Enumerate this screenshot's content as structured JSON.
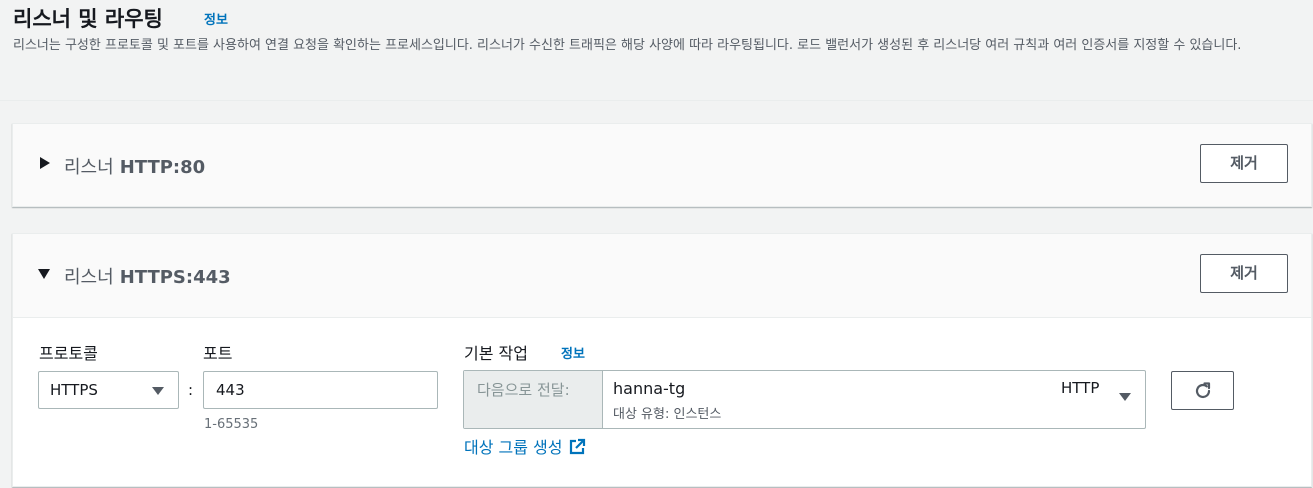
{
  "header": {
    "title": "리스너 및 라우팅",
    "info_link": "정보",
    "description": "리스너는 구성한 프로토콜 및 포트를 사용하여 연결 요청을 확인하는 프로세스입니다. 리스너가 수신한 트래픽은 해당 사양에 따라 라우팅됩니다. 로드 밸런서가 생성된 후 리스너당 여러 규칙과 여러 인증서를 지정할 수 있습니다."
  },
  "listeners": [
    {
      "label": "리스너",
      "port": "HTTP:80",
      "expanded": false,
      "remove_label": "제거"
    },
    {
      "label": "리스너",
      "port": "HTTPS:443",
      "expanded": true,
      "remove_label": "제거",
      "protocol_label": "프로토콜",
      "protocol_value": "HTTPS",
      "port_label": "포트",
      "port_value": "443",
      "port_hint": "1-65535",
      "default_action_label": "기본 작업",
      "default_action_info": "정보",
      "action_prefix": "다음으로 전달:",
      "target_group": "hanna-tg",
      "target_type": "대상 유형: 인스턴스",
      "target_protocol": "HTTP",
      "create_target_group": "대상 그룹 생성"
    }
  ],
  "icons": {
    "collapsed": "caret-right-icon",
    "expanded": "caret-down-icon",
    "refresh": "refresh-icon",
    "external_link": "external-link-icon"
  },
  "colors": {
    "link": "#0073bb",
    "text": "#16191f",
    "muted": "#545b64",
    "border": "#aab7b8"
  }
}
